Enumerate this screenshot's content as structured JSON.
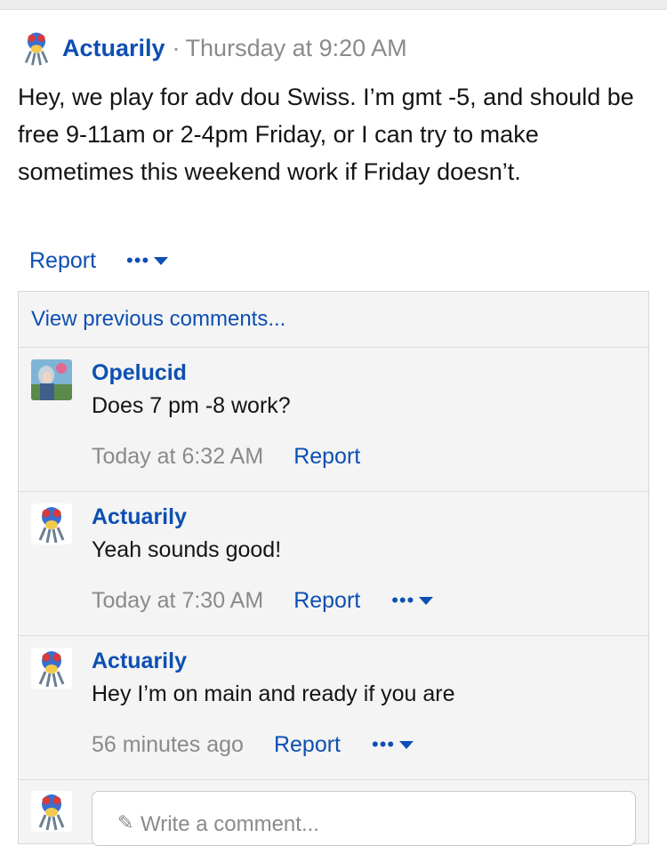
{
  "post": {
    "author": "Actuarily",
    "separator": "·",
    "time": "Thursday at 9:20 AM",
    "body": "Hey, we play for adv dou Swiss. I’m gmt -5, and should be free 9-11am or 2-4pm Friday, or I can try to make sometimes this weekend work if Friday doesn’t.",
    "report_label": "Report",
    "more_label": "•••"
  },
  "comments_section": {
    "view_previous": "View previous comments...",
    "comments": [
      {
        "author": "Opelucid",
        "text": "Does 7 pm -8 work?",
        "time": "Today at 6:32 AM",
        "report": "Report",
        "avatar": "anime-character-avatar"
      },
      {
        "author": "Actuarily",
        "text": "Yeah sounds good!",
        "time": "Today at 7:30 AM",
        "report": "Report",
        "more": "•••",
        "avatar": "pokemon-sprite-avatar"
      },
      {
        "author": "Actuarily",
        "text": "Hey I’m on main and ready if you are",
        "time": "56 minutes ago",
        "report": "Report",
        "more": "•••",
        "avatar": "pokemon-sprite-avatar"
      }
    ],
    "composer": {
      "placeholder": "Write a comment...",
      "icon": "pencil-icon"
    }
  },
  "colors": {
    "link": "#0d4fb3",
    "muted": "#8a8a8a",
    "panel": "#f4f4f4"
  }
}
